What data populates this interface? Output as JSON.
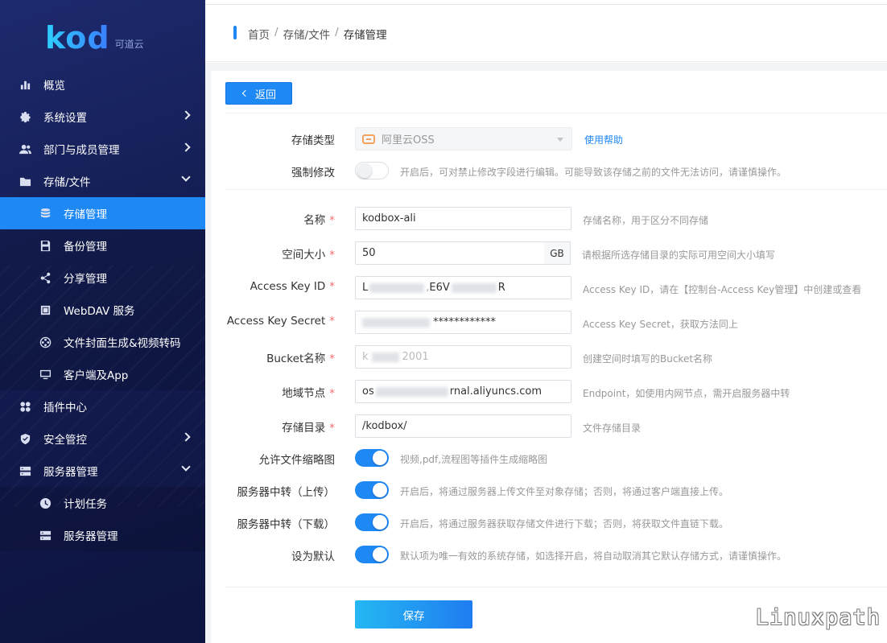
{
  "brand": {
    "logo_text": "kod",
    "logo_sub": "可道云"
  },
  "sidebar": {
    "items": [
      {
        "label": "概览",
        "icon": "bar-chart-icon",
        "arrow": ""
      },
      {
        "label": "系统设置",
        "icon": "gear-icon",
        "arrow": "right"
      },
      {
        "label": "部门与成员管理",
        "icon": "users-icon",
        "arrow": "right"
      },
      {
        "label": "存储/文件",
        "icon": "folder-icon",
        "arrow": "down"
      },
      {
        "label": "存储管理",
        "icon": "database-icon",
        "sub": true,
        "active": true
      },
      {
        "label": "备份管理",
        "icon": "save-icon",
        "sub": true
      },
      {
        "label": "分享管理",
        "icon": "share-icon",
        "sub": true
      },
      {
        "label": "WebDAV 服务",
        "icon": "webdav-icon",
        "sub": true
      },
      {
        "label": "文件封面生成&视频转码",
        "icon": "transcode-icon",
        "sub": true
      },
      {
        "label": "客户端及App",
        "icon": "monitor-icon",
        "sub": true
      },
      {
        "label": "插件中心",
        "icon": "plugin-icon",
        "arrow": ""
      },
      {
        "label": "安全管控",
        "icon": "shield-icon",
        "arrow": "right"
      },
      {
        "label": "服务器管理",
        "icon": "server-icon",
        "arrow": "down"
      },
      {
        "label": "计划任务",
        "icon": "clock-icon",
        "sub": true
      },
      {
        "label": "服务器管理",
        "icon": "server-icon",
        "sub": true
      }
    ]
  },
  "header": {
    "breadcrumb": [
      "首页",
      "存储/文件",
      "存储管理"
    ]
  },
  "actions": {
    "back_label": "返回",
    "save_label": "保存"
  },
  "form": {
    "storage_type": {
      "label": "存储类型",
      "value": "阿里云OSS",
      "help": "使用帮助"
    },
    "force_edit": {
      "label": "强制修改",
      "on": false,
      "hint": "开启后，可对禁止修改字段进行编辑。可能导致该存储之前的文件无法访问，请谨慎操作。"
    },
    "name": {
      "label": "名称",
      "value": "kodbox-ali",
      "hint": "存储名称，用于区分不同存储"
    },
    "size": {
      "label": "空间大小",
      "value": "50",
      "unit": "GB",
      "hint": "请根据所选存储目录的实际可用空间大小填写"
    },
    "access_key_id": {
      "label": "Access Key ID",
      "value_start": "L",
      "value_mid": "E6V",
      "value_end": "R",
      "hint": "Access Key ID，请在【控制台-Access Key管理】中创建或查看"
    },
    "access_key_secret": {
      "label": "Access Key Secret",
      "value_masked": "************",
      "hint": "Access Key Secret，获取方法同上"
    },
    "bucket": {
      "label": "Bucket名称",
      "value_start": "k",
      "value_end": "2001",
      "hint": "创建空间时填写的Bucket名称"
    },
    "endpoint": {
      "label": "地域节点",
      "value_start": "os",
      "value_end": "rnal.aliyuncs.com",
      "hint": "Endpoint，如使用内网节点，需开启服务器中转"
    },
    "dir": {
      "label": "存储目录",
      "value": "/kodbox/",
      "hint": "文件存储目录"
    },
    "thumb": {
      "label": "允许文件缩略图",
      "on": true,
      "hint": "视频,pdf,流程图等插件生成缩略图"
    },
    "proxy_upload": {
      "label": "服务器中转（上传）",
      "on": true,
      "hint": "开启后，将通过服务器上传文件至对象存储；否则，将通过客户端直接上传。"
    },
    "proxy_download": {
      "label": "服务器中转（下载）",
      "on": true,
      "hint": "开启后，将通过服务器获取存储文件进行下载；否则，将获取文件直链下载。"
    },
    "default": {
      "label": "设为默认",
      "on": true,
      "hint": "默认项为唯一有效的系统存储，如选择开启，将自动取消其它默认存储方式，请谨慎操作。"
    }
  },
  "watermark": "Linuxpath"
}
